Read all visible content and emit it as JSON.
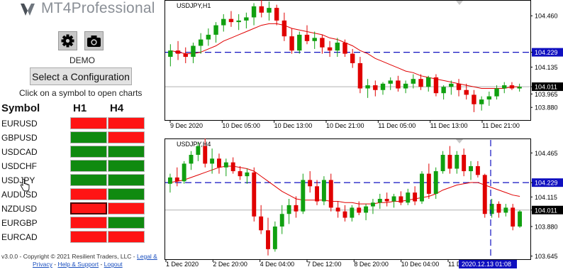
{
  "app": {
    "name": "MT4Professional",
    "account_mode": "DEMO"
  },
  "toolbar": {
    "settings_icon": "gear-icon",
    "screenshot_icon": "camera-icon"
  },
  "config_button": {
    "label": "Select a Configuration"
  },
  "hint": "Click on a symbol to open charts",
  "table": {
    "headers": [
      "Symbol",
      "H1",
      "H4"
    ],
    "rows": [
      {
        "symbol": "EURUSD",
        "h1": "red",
        "h4": "red"
      },
      {
        "symbol": "GBPUSD",
        "h1": "green",
        "h4": "red"
      },
      {
        "symbol": "USDCAD",
        "h1": "green",
        "h4": "green"
      },
      {
        "symbol": "USDCHF",
        "h1": "green",
        "h4": "green"
      },
      {
        "symbol": "USDJPY",
        "h1": "green",
        "h4": "green"
      },
      {
        "symbol": "AUDUSD",
        "h1": "red",
        "h4": "green"
      },
      {
        "symbol": "NZDUSD",
        "h1": "red",
        "h4": "red",
        "selected": true
      },
      {
        "symbol": "EURGBP",
        "h1": "red",
        "h4": "green"
      },
      {
        "symbol": "EURCAD",
        "h1": "red",
        "h4": "red"
      }
    ]
  },
  "footer": {
    "text": "v3.0.0 - Copyright © 2021 Resilient Traders, LLC -",
    "link1": "Legal &",
    "link1b": "Privacy",
    "link2": "Help & Support",
    "link3": "Logout"
  },
  "colors": {
    "bull": "#10a010",
    "bear": "#e00000",
    "ma": "#e00000",
    "level": "#1010c0",
    "red_cell": "#ff1414",
    "green_cell": "#108a10"
  },
  "chart_data": [
    {
      "type": "candlestick",
      "title": "USDJPY,H1",
      "ylim": [
        103.8,
        104.56
      ],
      "yticks": [
        "104.460",
        "104.229",
        "104.135",
        "104.011",
        "103.965",
        "103.880"
      ],
      "xticks": [
        "9 Dec 2020",
        "10 Dec 05:00",
        "10 Dec 13:00",
        "10 Dec 21:00",
        "11 Dec 05:00",
        "11 Dec 13:00",
        "11 Dec 21:00"
      ],
      "level_line": 104.229,
      "last_price": 104.011,
      "ohlc": [
        [
          104.2,
          104.28,
          104.14,
          104.24
        ],
        [
          104.24,
          104.3,
          104.18,
          104.22
        ],
        [
          104.22,
          104.26,
          104.16,
          104.2
        ],
        [
          104.2,
          104.29,
          104.16,
          104.27
        ],
        [
          104.27,
          104.35,
          104.22,
          104.31
        ],
        [
          104.31,
          104.38,
          104.27,
          104.34
        ],
        [
          104.34,
          104.42,
          104.29,
          104.4
        ],
        [
          104.4,
          104.47,
          104.36,
          104.44
        ],
        [
          104.44,
          104.49,
          104.39,
          104.42
        ],
        [
          104.42,
          104.47,
          104.37,
          104.43
        ],
        [
          104.43,
          104.48,
          104.38,
          104.45
        ],
        [
          104.45,
          104.54,
          104.4,
          104.52
        ],
        [
          104.52,
          104.57,
          104.45,
          104.48
        ],
        [
          104.48,
          104.55,
          104.43,
          104.51
        ],
        [
          104.51,
          104.53,
          104.4,
          104.43
        ],
        [
          104.43,
          104.48,
          104.3,
          104.33
        ],
        [
          104.33,
          104.38,
          104.22,
          104.24
        ],
        [
          104.24,
          104.36,
          104.22,
          104.34
        ],
        [
          104.34,
          104.4,
          104.28,
          104.3
        ],
        [
          104.3,
          104.36,
          104.25,
          104.32
        ],
        [
          104.32,
          104.34,
          104.22,
          104.26
        ],
        [
          104.26,
          104.3,
          104.2,
          104.24
        ],
        [
          104.24,
          104.32,
          104.2,
          104.29
        ],
        [
          104.29,
          104.31,
          104.2,
          104.22
        ],
        [
          104.22,
          104.25,
          104.13,
          104.16
        ],
        [
          104.16,
          104.2,
          103.97,
          104.0
        ],
        [
          104.0,
          104.06,
          103.94,
          104.02
        ],
        [
          104.02,
          104.05,
          103.95,
          103.99
        ],
        [
          103.99,
          104.04,
          103.96,
          104.03
        ],
        [
          104.03,
          104.07,
          103.99,
          104.05
        ],
        [
          104.05,
          104.08,
          103.98,
          104.0
        ],
        [
          104.0,
          104.05,
          103.97,
          104.03
        ],
        [
          104.03,
          104.09,
          104.0,
          104.06
        ],
        [
          104.06,
          104.09,
          103.99,
          104.01
        ],
        [
          104.01,
          104.08,
          103.98,
          104.07
        ],
        [
          104.07,
          104.09,
          103.95,
          103.97
        ],
        [
          103.97,
          104.02,
          103.93,
          104.01
        ],
        [
          104.01,
          104.05,
          103.96,
          104.03
        ],
        [
          104.03,
          104.06,
          103.95,
          103.99
        ],
        [
          103.99,
          104.03,
          103.93,
          103.96
        ],
        [
          103.96,
          103.99,
          103.85,
          103.9
        ],
        [
          103.9,
          103.95,
          103.86,
          103.93
        ],
        [
          103.93,
          103.98,
          103.89,
          103.95
        ],
        [
          103.95,
          104.02,
          103.93,
          104.0
        ],
        [
          104.0,
          104.04,
          103.97,
          104.02
        ],
        [
          104.02,
          104.04,
          103.99,
          104.0
        ],
        [
          104.0,
          104.03,
          103.98,
          104.01
        ]
      ],
      "ma": [
        104.24,
        104.23,
        104.22,
        104.22,
        104.23,
        104.25,
        104.27,
        104.3,
        104.32,
        104.34,
        104.36,
        104.38,
        104.4,
        104.41,
        104.41,
        104.4,
        104.38,
        104.37,
        104.36,
        104.35,
        104.34,
        104.32,
        104.31,
        104.29,
        104.27,
        104.24,
        104.22,
        104.19,
        104.17,
        104.15,
        104.13,
        104.11,
        104.1,
        104.08,
        104.07,
        104.06,
        104.05,
        104.04,
        104.03,
        104.02,
        104.01,
        104.0,
        104.0,
        104.0,
        104.0,
        104.01,
        104.01
      ]
    },
    {
      "type": "candlestick",
      "title": "USDJPY,H4",
      "ylim": [
        103.62,
        104.58
      ],
      "yticks": [
        "104.465",
        "104.229",
        "104.115",
        "104.011",
        "103.880",
        "103.645"
      ],
      "xticks": [
        "1 Dec 2020",
        "2 Dec 20:00",
        "4 Dec 04:00",
        "7 Dec 12:00",
        "8 Dec 20:00",
        "10 Dec 04:00",
        "11 Dec"
      ],
      "crosshair_label": "2020.12.13 01:08",
      "level_line": 104.229,
      "last_price": 104.011,
      "ohlc": [
        [
          104.22,
          104.3,
          104.15,
          104.27
        ],
        [
          104.27,
          104.35,
          104.2,
          104.24
        ],
        [
          104.24,
          104.4,
          104.22,
          104.38
        ],
        [
          104.38,
          104.48,
          104.33,
          104.45
        ],
        [
          104.45,
          104.55,
          104.4,
          104.52
        ],
        [
          104.52,
          104.58,
          104.35,
          104.38
        ],
        [
          104.38,
          104.5,
          104.3,
          104.42
        ],
        [
          104.42,
          104.46,
          104.3,
          104.35
        ],
        [
          104.35,
          104.42,
          104.28,
          104.39
        ],
        [
          104.39,
          104.43,
          104.3,
          104.32
        ],
        [
          104.32,
          104.36,
          104.25,
          104.28
        ],
        [
          104.28,
          104.34,
          104.22,
          104.31
        ],
        [
          104.31,
          104.35,
          103.92,
          103.96
        ],
        [
          103.96,
          104.05,
          103.82,
          103.85
        ],
        [
          103.85,
          103.95,
          103.65,
          103.7
        ],
        [
          103.7,
          103.92,
          103.68,
          103.88
        ],
        [
          103.88,
          104.05,
          103.82,
          103.98
        ],
        [
          103.98,
          104.1,
          103.9,
          104.05
        ],
        [
          104.05,
          104.12,
          103.95,
          104.0
        ],
        [
          104.0,
          104.3,
          103.98,
          104.25
        ],
        [
          104.25,
          104.32,
          104.15,
          104.2
        ],
        [
          104.2,
          104.25,
          104.05,
          104.08
        ],
        [
          104.08,
          104.28,
          104.05,
          104.25
        ],
        [
          104.25,
          104.3,
          104.0,
          104.03
        ],
        [
          104.03,
          104.08,
          103.95,
          104.0
        ],
        [
          104.0,
          104.05,
          103.92,
          103.95
        ],
        [
          103.95,
          104.05,
          103.92,
          104.03
        ],
        [
          104.03,
          104.08,
          103.97,
          103.99
        ],
        [
          103.99,
          104.06,
          103.93,
          104.04
        ],
        [
          104.04,
          104.1,
          103.98,
          104.07
        ],
        [
          104.07,
          104.14,
          104.02,
          104.1
        ],
        [
          104.1,
          104.15,
          104.04,
          104.08
        ],
        [
          104.08,
          104.14,
          104.03,
          104.12
        ],
        [
          104.12,
          104.16,
          104.05,
          104.07
        ],
        [
          104.07,
          104.18,
          104.05,
          104.15
        ],
        [
          104.15,
          104.2,
          104.05,
          104.08
        ],
        [
          104.08,
          104.32,
          104.06,
          104.3
        ],
        [
          104.3,
          104.38,
          104.1,
          104.14
        ],
        [
          104.14,
          104.35,
          104.1,
          104.32
        ],
        [
          104.32,
          104.48,
          104.3,
          104.45
        ],
        [
          104.45,
          104.52,
          104.3,
          104.34
        ],
        [
          104.34,
          104.48,
          104.3,
          104.45
        ],
        [
          104.45,
          104.5,
          104.28,
          104.32
        ],
        [
          104.32,
          104.4,
          104.25,
          104.36
        ],
        [
          104.36,
          104.4,
          104.27,
          104.29
        ],
        [
          104.29,
          104.3,
          103.95,
          103.98
        ],
        [
          103.98,
          104.1,
          103.95,
          104.06
        ],
        [
          104.06,
          104.08,
          103.95,
          103.99
        ],
        [
          103.99,
          104.06,
          103.96,
          104.03
        ],
        [
          104.03,
          104.06,
          103.85,
          103.88
        ],
        [
          103.88,
          104.01,
          103.87,
          104.0
        ]
      ],
      "ma": [
        104.23,
        104.24,
        104.25,
        104.27,
        104.29,
        104.31,
        104.33,
        104.35,
        104.36,
        104.36,
        104.35,
        104.34,
        104.32,
        104.28,
        104.24,
        104.2,
        104.16,
        104.13,
        104.1,
        104.09,
        104.09,
        104.09,
        104.09,
        104.08,
        104.08,
        104.07,
        104.07,
        104.06,
        104.06,
        104.06,
        104.07,
        104.07,
        104.08,
        104.08,
        104.09,
        104.1,
        104.11,
        104.12,
        104.14,
        104.17,
        104.19,
        104.21,
        104.22,
        104.23,
        104.23,
        104.21,
        104.19,
        104.17,
        104.15,
        104.13,
        104.12
      ]
    }
  ]
}
